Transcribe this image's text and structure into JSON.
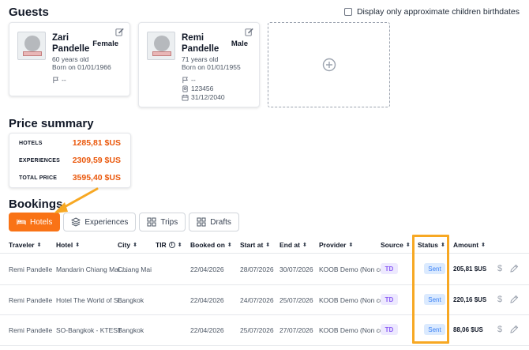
{
  "guests": {
    "title": "Guests",
    "approx_label": "Display only approximate children birthdates",
    "cards": [
      {
        "first": "Zari",
        "last": "Pandelle",
        "sex": "Female",
        "age": "60 years old",
        "born": "Born on 01/01/1966",
        "flag_value": "--"
      },
      {
        "first": "Remi",
        "last": "Pandelle",
        "sex": "Male",
        "age": "71 years old",
        "born": "Born on 01/01/1955",
        "flag_value": "--",
        "passport": "123456",
        "expiry": "31/12/2040"
      }
    ]
  },
  "price_summary": {
    "title": "Price summary",
    "rows": [
      {
        "label": "HOTELS",
        "value": "1285,81 $US"
      },
      {
        "label": "EXPERIENCES",
        "value": "2309,59 $US"
      },
      {
        "label": "TOTAL PRICE",
        "value": "3595,40 $US"
      }
    ]
  },
  "bookings": {
    "title": "Bookings",
    "tabs": [
      {
        "label": "Hotels",
        "icon": "bed-icon",
        "active": true
      },
      {
        "label": "Experiences",
        "icon": "layers-icon",
        "active": false
      },
      {
        "label": "Trips",
        "icon": "grid-icon",
        "active": false
      },
      {
        "label": "Drafts",
        "icon": "grid-icon",
        "active": false
      }
    ],
    "columns": {
      "traveler": "Traveler",
      "hotel": "Hotel",
      "city": "City",
      "tir": "TIR",
      "booked_on": "Booked on",
      "start_at": "Start at",
      "end_at": "End at",
      "provider": "Provider",
      "source": "Source",
      "status": "Status",
      "amount": "Amount"
    },
    "sort_glyph": "⬍",
    "info_glyph": "i",
    "rows": [
      {
        "traveler": "Remi Pandelle",
        "hotel": "Mandarin Chiang Mai ...",
        "city": "Chiang Mai",
        "booked_on": "22/04/2026",
        "start_at": "28/07/2026",
        "end_at": "30/07/2026",
        "provider": "KOOB Demo (Non co...",
        "source": "TD",
        "status": "Sent",
        "amount": "205,81 $US"
      },
      {
        "traveler": "Remi Pandelle",
        "hotel": "Hotel The World of Si...",
        "city": "Bangkok",
        "booked_on": "22/04/2026",
        "start_at": "24/07/2026",
        "end_at": "25/07/2026",
        "provider": "KOOB Demo (Non co...",
        "source": "TD",
        "status": "Sent",
        "amount": "220,16 $US"
      },
      {
        "traveler": "Remi Pandelle",
        "hotel": "SO-Bangkok - KTEST",
        "city": "Bangkok",
        "booked_on": "22/04/2026",
        "start_at": "25/07/2026",
        "end_at": "27/07/2026",
        "provider": "KOOB Demo (Non co...",
        "source": "TD",
        "status": "Sent",
        "amount": "88,06 $US"
      }
    ],
    "dollar_glyph": "$"
  },
  "colors": {
    "accent": "#f97316",
    "price": "#ea580c",
    "highlight": "#f7a823",
    "badge_td_bg": "#ede9fe",
    "badge_sent_bg": "#dbeafe"
  }
}
